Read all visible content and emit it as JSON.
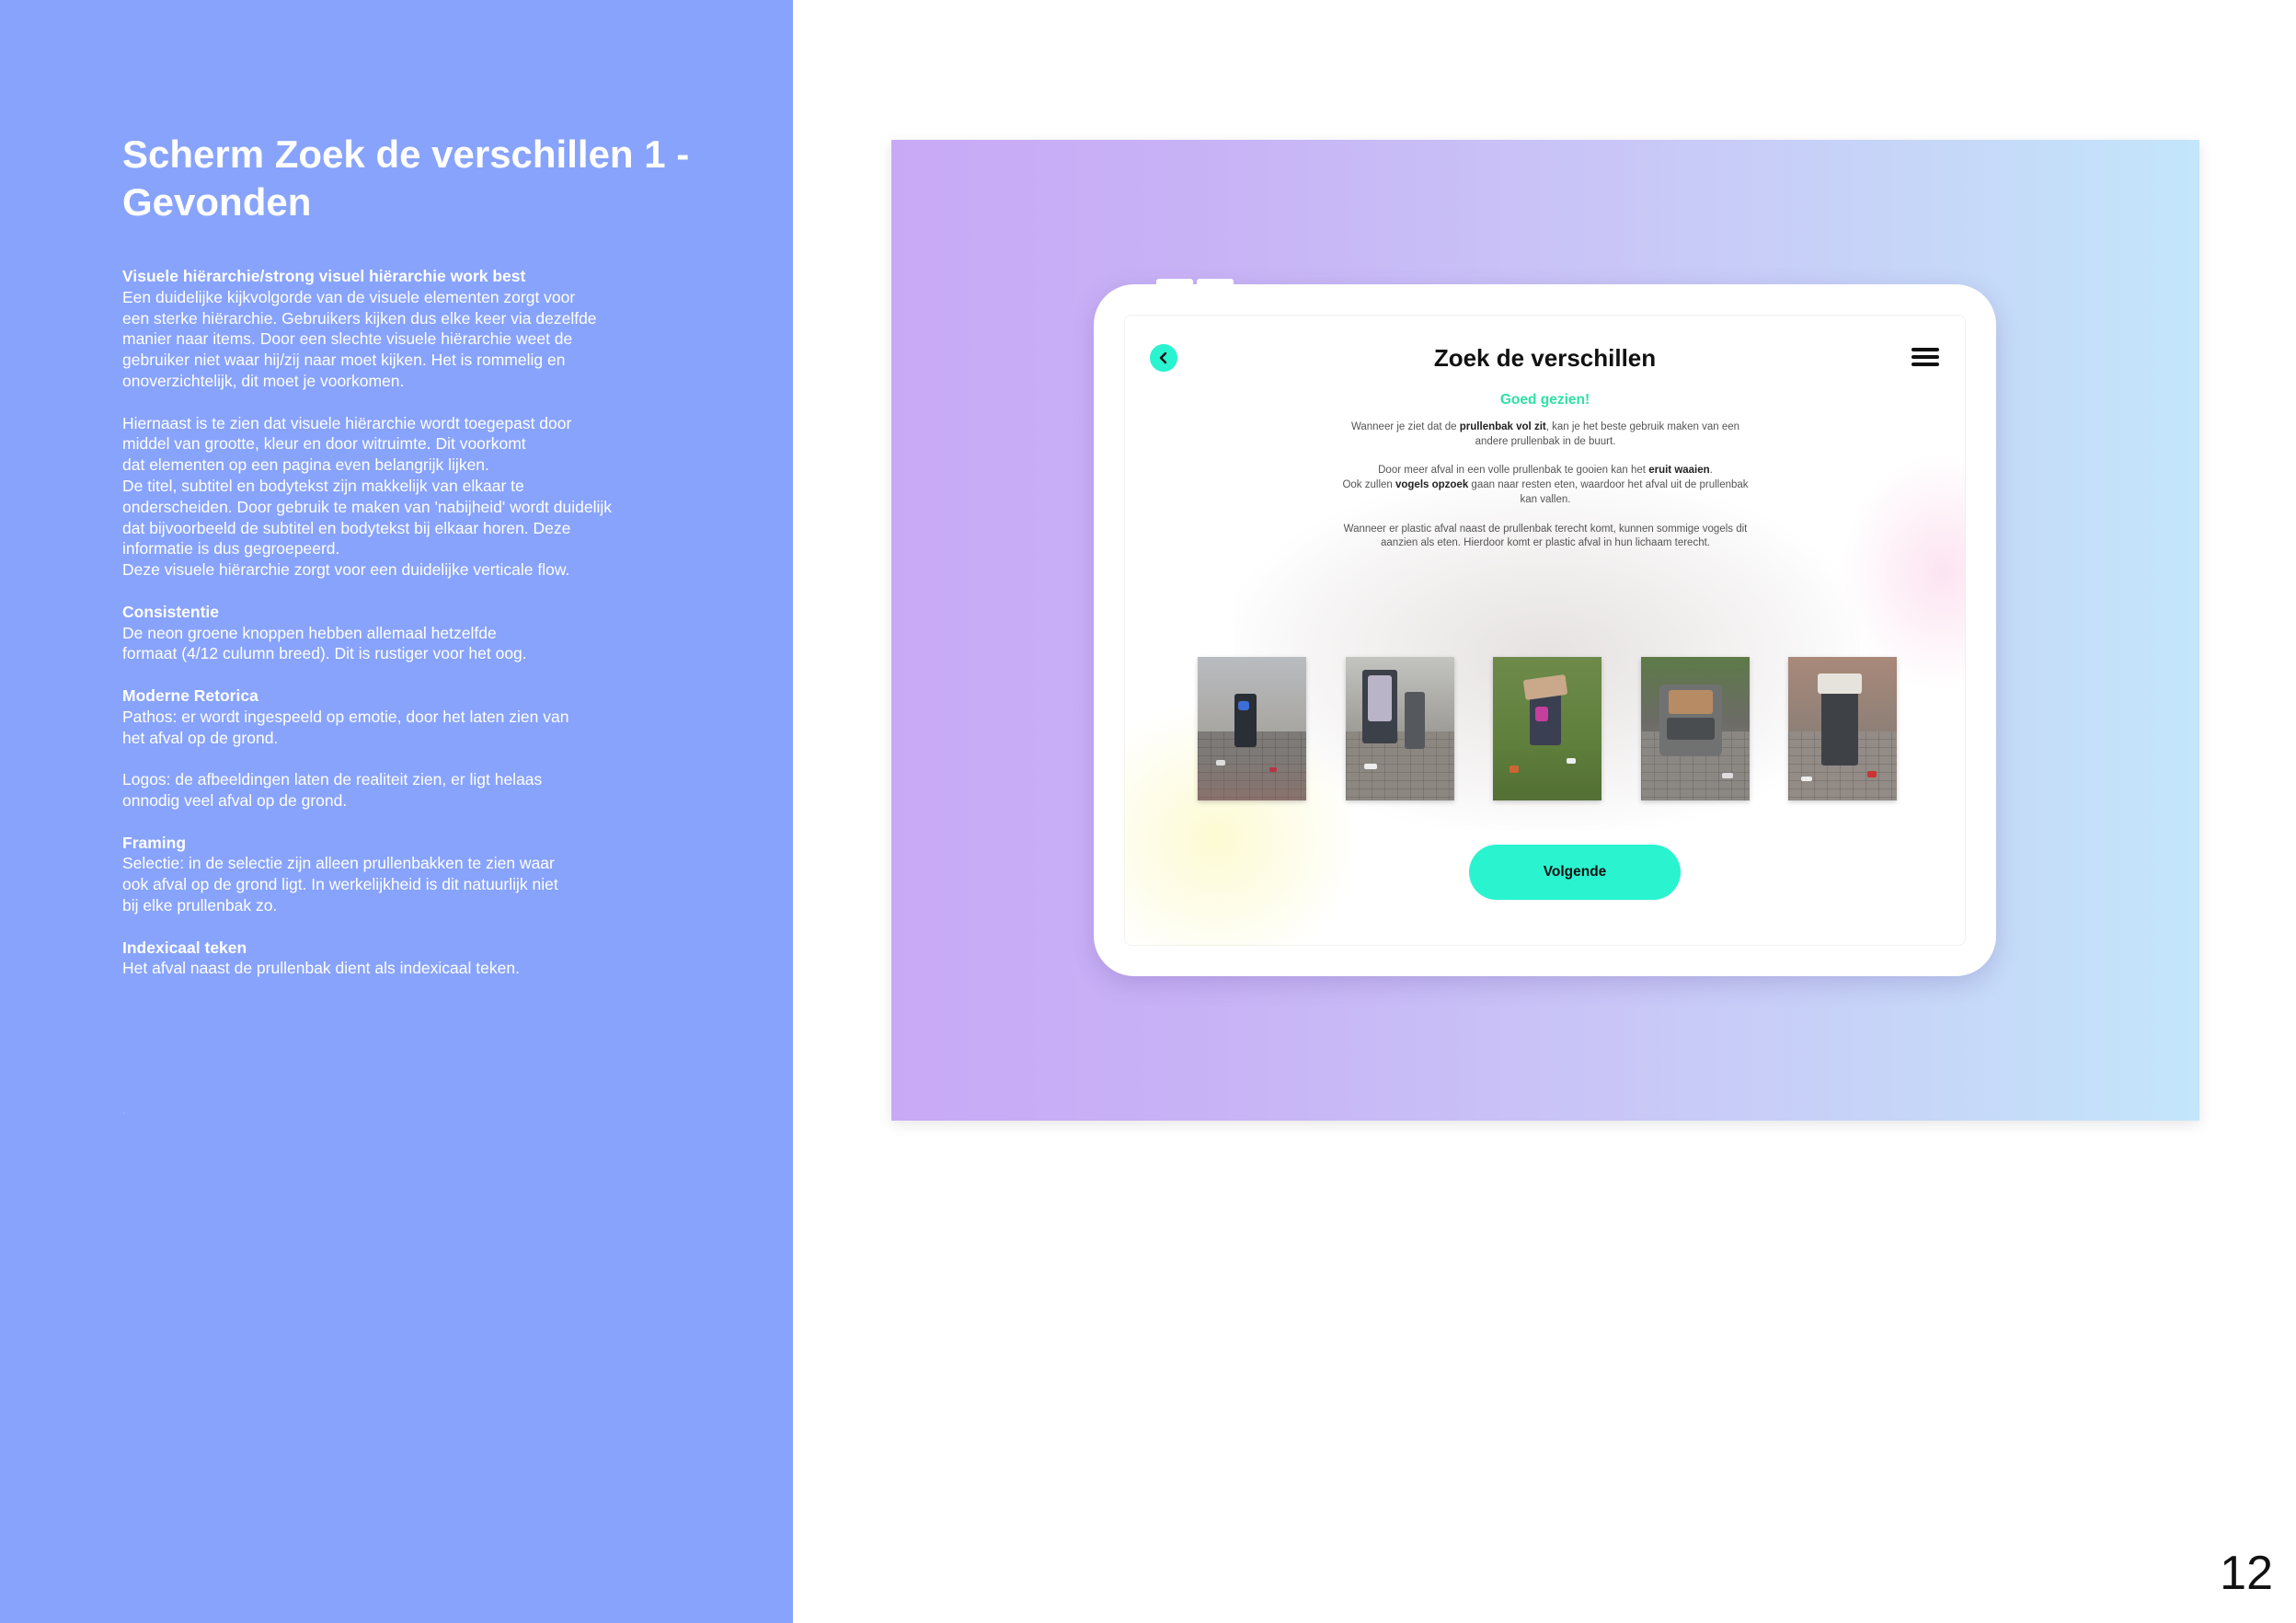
{
  "left": {
    "title": "Scherm Zoek de verschillen 1  - Gevonden",
    "sections": [
      {
        "heading": "Visuele hiërarchie/strong visuel hiërarchie work best",
        "body": "Een duidelijke kijkvolgorde van de visuele elementen zorgt voor\neen sterke hiërarchie. Gebruikers kijken dus elke keer via dezelfde\nmanier naar items. Door een slechte visuele hiërarchie weet de\ngebruiker niet waar hij/zij naar moet kijken. Het is rommelig en\nonoverzichtelijk, dit moet je voorkomen."
      },
      {
        "heading": "",
        "body": "Hiernaast is te zien dat visuele hiërarchie wordt toegepast door\nmiddel van grootte, kleur en door witruimte. Dit voorkomt\ndat elementen op een pagina even belangrijk lijken.\nDe titel, subtitel en bodytekst zijn makkelijk van elkaar te\nonderscheiden. Door gebruik te maken van 'nabijheid' wordt duidelijk\ndat bijvoorbeeld de subtitel en bodytekst bij elkaar horen. Deze\ninformatie is dus gegroepeerd.\nDeze visuele hiërarchie zorgt voor een duidelijke verticale flow."
      },
      {
        "heading": "Consistentie",
        "body": "De neon groene knoppen hebben allemaal hetzelfde\nformaat (4/12 culumn breed). Dit is rustiger voor het oog."
      },
      {
        "heading": "Moderne Retorica",
        "body": "Pathos: er wordt ingespeeld op emotie, door het laten zien van\nhet afval op de grond."
      },
      {
        "heading": "",
        "body": "Logos: de afbeeldingen laten de realiteit zien, er ligt helaas\nonnodig veel afval op de grond."
      },
      {
        "heading": "Framing",
        "body": "Selectie: in de selectie zijn alleen prullenbakken te zien waar\nook afval op de grond ligt. In werkelijkheid is dit natuurlijk niet\nbij elke prullenbak zo."
      },
      {
        "heading": "Indexicaal teken",
        "body": "Het afval naast de prullenbak dient als indexicaal teken."
      }
    ],
    "stray_mark": "."
  },
  "mockup": {
    "screen_title": "Zoek de verschillen",
    "subtitle": "Goed gezien!",
    "p1_a": "Wanneer je ziet dat de ",
    "p1_b": "prullenbak vol zit",
    "p1_c": ", kan je het beste gebruik maken van een andere prullenbak in de buurt.",
    "p2_a": "Door meer afval in een volle prullenbak te gooien kan het ",
    "p2_b": "eruit waaien",
    "p2_c": ".",
    "p2_d": "Ook zullen ",
    "p2_e": "vogels opzoek",
    "p2_f": " gaan naar resten eten, waardoor het afval uit de prullenbak kan vallen.",
    "p3": "Wanneer er plastic afval naast de prullenbak terecht komt, kunnen sommige vogels dit aanzien als eten. Hierdoor komt er plastic afval in hun lichaam terecht.",
    "button_label": "Volgende",
    "icons": {
      "back": "chevron-left-icon",
      "menu": "hamburger-menu-icon"
    },
    "photos": [
      "photo-bin-square",
      "photo-bin-bus-shelter",
      "photo-bin-grass-overflowing",
      "photo-underground-container",
      "photo-bin-sidewalk-overflowing"
    ]
  },
  "colors": {
    "left_panel": "#88a3fc",
    "accent_button": "#2af3d0",
    "subtitle_green": "#2ee1a4",
    "gradient_start": "#c8a9f6",
    "gradient_end": "#c3e6fb"
  },
  "page_number": "12"
}
